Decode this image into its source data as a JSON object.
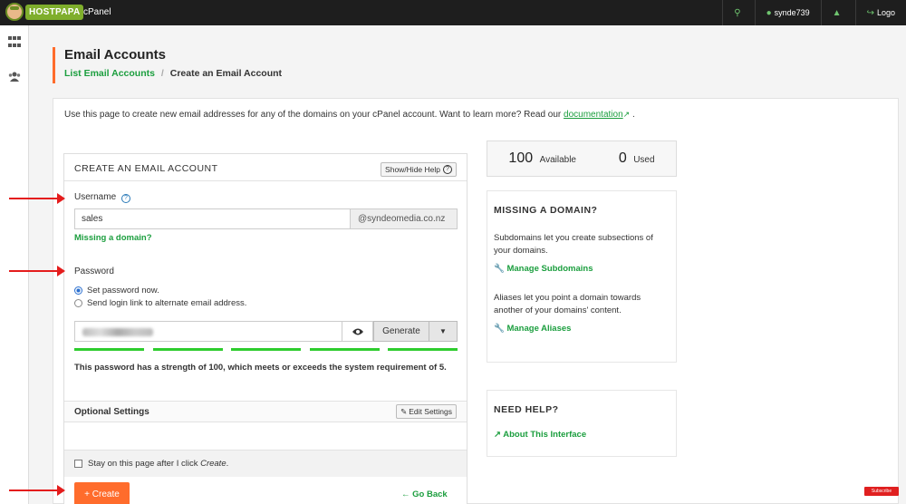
{
  "topbar": {
    "logo_text": "HOSTPAPA",
    "app_name": "cPanel",
    "username": "synde739",
    "logout_label": "Logo"
  },
  "header": {
    "title": "Email Accounts",
    "breadcrumb_link": "List Email Accounts",
    "breadcrumb_sep": "/",
    "breadcrumb_current": "Create an Email Account"
  },
  "intro": {
    "text": "Use this page to create new email addresses for any of the domains on your cPanel account. Want to learn more? Read our",
    "link": "documentation",
    "suffix": "."
  },
  "form": {
    "title": "CREATE AN EMAIL ACCOUNT",
    "help_button": "Show/Hide Help",
    "username_label": "Username",
    "username_value": "sales",
    "domain": "@syndeomedia.co.nz",
    "missing_domain_link": "Missing a domain?",
    "password_label": "Password",
    "radio_set_password": "Set password now.",
    "radio_send_link": "Send login link to alternate email address.",
    "generate_button": "Generate",
    "strength_text": "This password has a strength of 100, which meets or exceeds the system requirement of 5.",
    "strength_percent": 100,
    "optional_settings": "Optional Settings",
    "edit_settings_button": "Edit Settings",
    "stay_label_prefix": "Stay on this page after I click ",
    "stay_label_emph": "Create",
    "stay_label_suffix": ".",
    "create_button": "+ Create",
    "go_back": "Go Back"
  },
  "stats": {
    "available_num": "100",
    "available_label": "Available",
    "used_num": "0",
    "used_label": "Used"
  },
  "missing_domain_card": {
    "title": "MISSING A DOMAIN?",
    "subdomains_text": "Subdomains let you create subsections of your domains.",
    "subdomains_link": "Manage Subdomains",
    "aliases_text": "Aliases let you point a domain towards another of your domains' content.",
    "aliases_link": "Manage Aliases"
  },
  "help_card": {
    "title": "NEED HELP?",
    "link": "About This Interface"
  },
  "overlay": {
    "subscribe": "Subscribe"
  },
  "colors": {
    "accent_orange": "#ff6c2c",
    "link_green": "#1b9e3e",
    "strength_green": "#2ecc2e",
    "annotation_red": "#e41c1c"
  }
}
